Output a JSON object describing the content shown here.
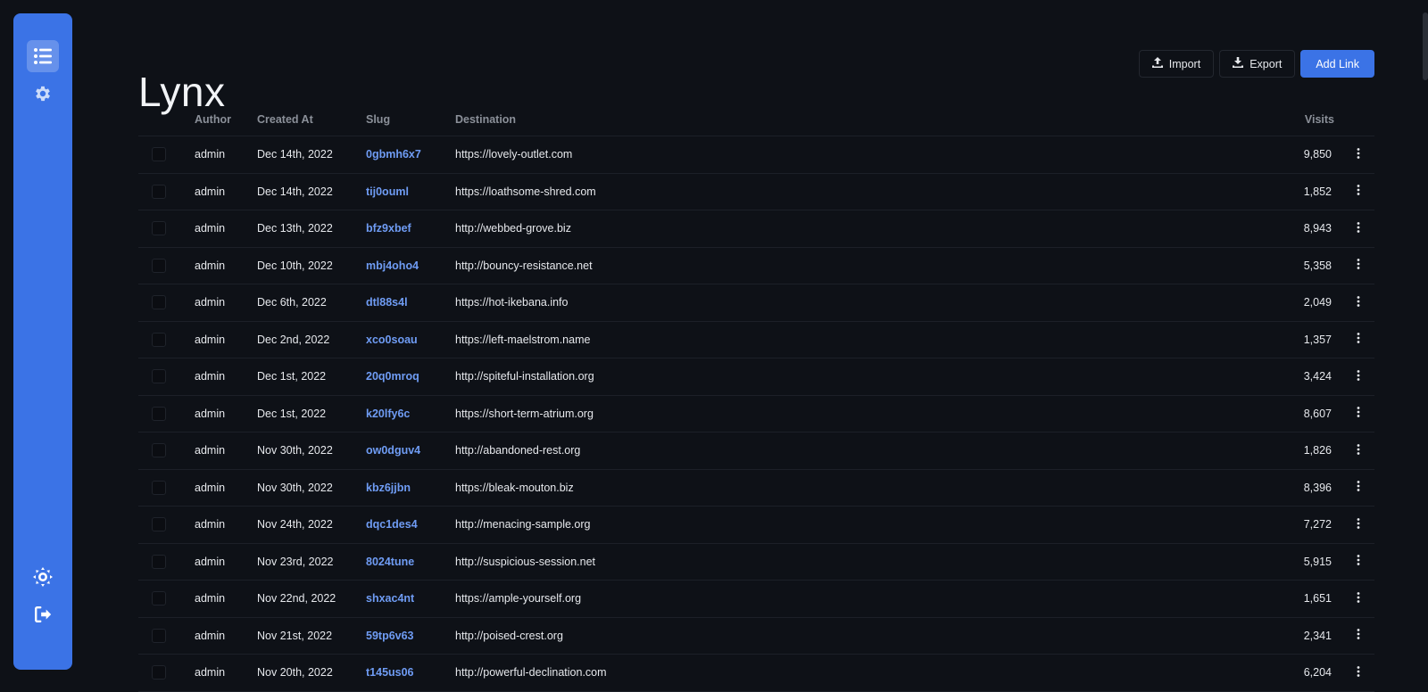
{
  "app": {
    "title": "Lynx"
  },
  "sidebar": {
    "accent_color": "#3b73e6",
    "items": [
      {
        "icon": "list-icon",
        "active": true
      },
      {
        "icon": "gear-icon",
        "active": false
      }
    ],
    "bottom_items": [
      {
        "icon": "sun-icon"
      },
      {
        "icon": "logout-icon"
      }
    ]
  },
  "toolbar": {
    "import_label": "Import",
    "export_label": "Export",
    "add_label": "Add Link"
  },
  "table": {
    "columns": {
      "author": "Author",
      "created": "Created At",
      "slug": "Slug",
      "destination": "Destination",
      "visits": "Visits"
    },
    "rows": [
      {
        "author": "admin",
        "created": "Dec 14th, 2022",
        "slug": "0gbmh6x7",
        "destination": "https://lovely-outlet.com",
        "visits": "9,850"
      },
      {
        "author": "admin",
        "created": "Dec 14th, 2022",
        "slug": "tij0ouml",
        "destination": "https://loathsome-shred.com",
        "visits": "1,852"
      },
      {
        "author": "admin",
        "created": "Dec 13th, 2022",
        "slug": "bfz9xbef",
        "destination": "http://webbed-grove.biz",
        "visits": "8,943"
      },
      {
        "author": "admin",
        "created": "Dec 10th, 2022",
        "slug": "mbj4oho4",
        "destination": "http://bouncy-resistance.net",
        "visits": "5,358"
      },
      {
        "author": "admin",
        "created": "Dec 6th, 2022",
        "slug": "dtl88s4l",
        "destination": "https://hot-ikebana.info",
        "visits": "2,049"
      },
      {
        "author": "admin",
        "created": "Dec 2nd, 2022",
        "slug": "xco0soau",
        "destination": "https://left-maelstrom.name",
        "visits": "1,357"
      },
      {
        "author": "admin",
        "created": "Dec 1st, 2022",
        "slug": "20q0mroq",
        "destination": "http://spiteful-installation.org",
        "visits": "3,424"
      },
      {
        "author": "admin",
        "created": "Dec 1st, 2022",
        "slug": "k20lfy6c",
        "destination": "https://short-term-atrium.org",
        "visits": "8,607"
      },
      {
        "author": "admin",
        "created": "Nov 30th, 2022",
        "slug": "ow0dguv4",
        "destination": "http://abandoned-rest.org",
        "visits": "1,826"
      },
      {
        "author": "admin",
        "created": "Nov 30th, 2022",
        "slug": "kbz6jjbn",
        "destination": "https://bleak-mouton.biz",
        "visits": "8,396"
      },
      {
        "author": "admin",
        "created": "Nov 24th, 2022",
        "slug": "dqc1des4",
        "destination": "http://menacing-sample.org",
        "visits": "7,272"
      },
      {
        "author": "admin",
        "created": "Nov 23rd, 2022",
        "slug": "8024tune",
        "destination": "http://suspicious-session.net",
        "visits": "5,915"
      },
      {
        "author": "admin",
        "created": "Nov 22nd, 2022",
        "slug": "shxac4nt",
        "destination": "https://ample-yourself.org",
        "visits": "1,651"
      },
      {
        "author": "admin",
        "created": "Nov 21st, 2022",
        "slug": "59tp6v63",
        "destination": "http://poised-crest.org",
        "visits": "2,341"
      },
      {
        "author": "admin",
        "created": "Nov 20th, 2022",
        "slug": "t145us06",
        "destination": "http://powerful-declination.com",
        "visits": "6,204"
      }
    ]
  }
}
